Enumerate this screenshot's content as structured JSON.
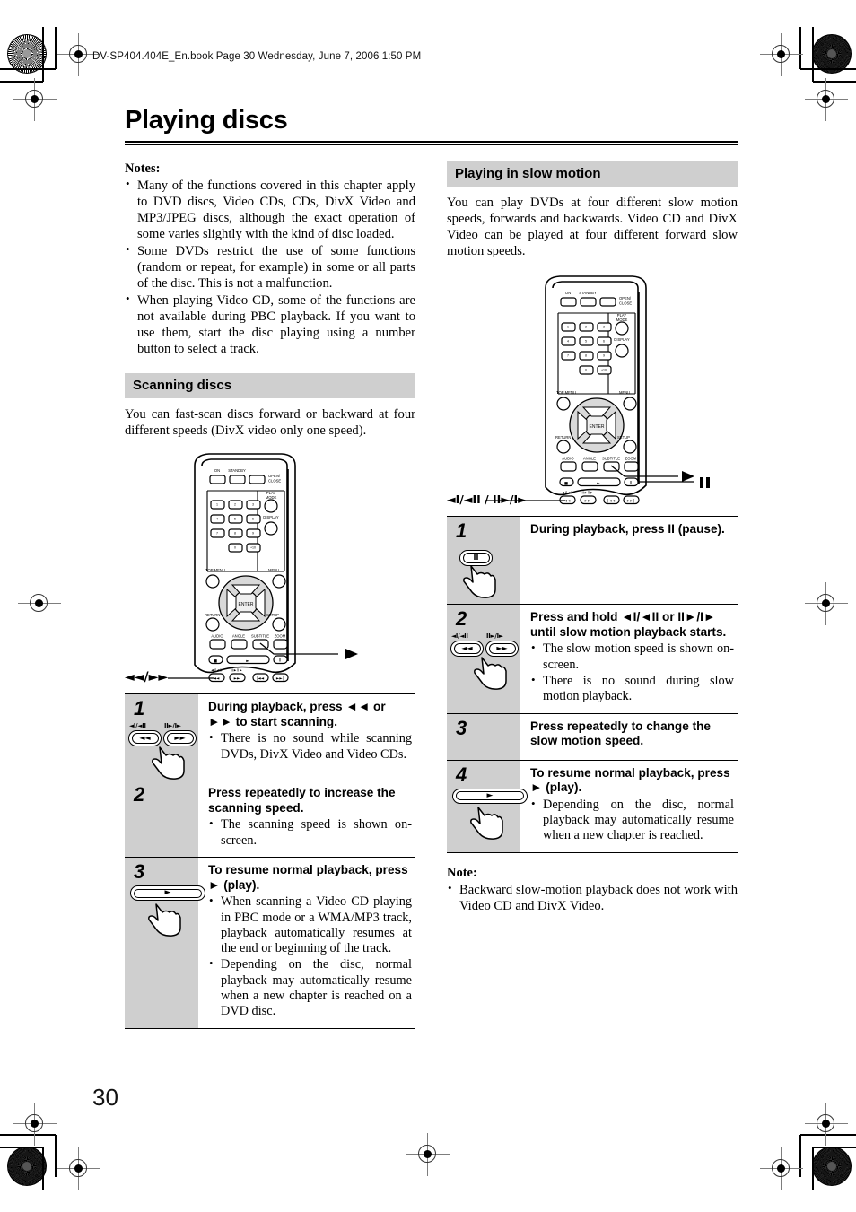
{
  "header": {
    "file_line": "DV-SP404.404E_En.book  Page 30  Wednesday, June 7, 2006  1:50 PM"
  },
  "page": {
    "title": "Playing discs",
    "page_number": "30"
  },
  "notes": {
    "heading": "Notes:",
    "items": [
      "Many of the functions covered in this chapter apply to DVD discs, Video CDs, CDs, DivX Video and MP3/JPEG discs, although the exact operation of some varies slightly with the kind of disc loaded.",
      "Some DVDs restrict the use of some functions (random or repeat, for example) in some or all parts of the disc. This is not a malfunction.",
      "When playing Video CD, some of the functions are not available during PBC playback. If you want to use them, start the disc playing using a number button to select a track."
    ]
  },
  "scanning": {
    "heading": "Scanning discs",
    "intro": "You can fast-scan discs forward or backward at four different speeds (DivX video only one speed).",
    "remote_callout_play": "►",
    "remote_callout_scan": "◄◄/►►",
    "steps": [
      {
        "num": "1",
        "heading": "During playback, press ◄◄ or ►► to start scanning.",
        "bullets": [
          "There is no sound while scanning DVDs, DivX Video and Video CDs."
        ],
        "button_left_label": "◄I/◄II",
        "button_right_label": "II►/I►",
        "button_left_glyph": "◄◄",
        "button_right_glyph": "►►"
      },
      {
        "num": "2",
        "heading": "Press repeatedly to increase the scanning speed.",
        "bullets": [
          "The scanning speed is shown on-screen."
        ]
      },
      {
        "num": "3",
        "heading": "To resume normal playback, press ► (play).",
        "bullets": [
          "When scanning a Video CD playing in PBC mode or a WMA/MP3 track, playback automatically resumes at the end or beginning of the track.",
          "Depending on the disc, normal playback may automatically resume when a new chapter is reached on a DVD disc."
        ],
        "play_glyph": "►"
      }
    ]
  },
  "slow_motion": {
    "heading": "Playing in slow motion",
    "intro": "You can play DVDs at four different slow motion speeds, forwards and backwards. Video CD and DivX Video can be played at four different forward slow motion speeds.",
    "remote_callout_play": "►",
    "remote_callout_pause": "II",
    "remote_callout_slow": "◄I/◄II / II►/I►",
    "steps": [
      {
        "num": "1",
        "heading": "During playback, press II (pause).",
        "bullets": [],
        "button_glyph": "II"
      },
      {
        "num": "2",
        "heading": "Press and hold ◄I/◄II or II►/I► until slow motion playback starts.",
        "bullets": [
          "The slow motion speed is shown on-screen.",
          "There is no sound during slow motion playback."
        ],
        "button_left_label": "◄I/◄II",
        "button_right_label": "II►/I►",
        "button_left_glyph": "◄◄",
        "button_right_glyph": "►►"
      },
      {
        "num": "3",
        "heading": "Press repeatedly to change the slow motion speed.",
        "bullets": []
      },
      {
        "num": "4",
        "heading": "To resume normal playback, press ► (play).",
        "bullets": [
          "Depending on the disc, normal playback may automatically resume when a new chapter is reached."
        ],
        "play_glyph": "►"
      }
    ],
    "note": {
      "heading": "Note:",
      "items": [
        "Backward slow-motion playback does not work with Video CD and DivX Video."
      ]
    }
  },
  "remote": {
    "labels": {
      "on": "ON",
      "standby": "STANDBY",
      "open_close": "OPEN/ CLOSE",
      "play_mode": "PLAY MODE",
      "display": "DISPLAY",
      "top_menu": "TOP MENU",
      "menu": "MENU",
      "return": "RETURN",
      "setup": "SETUP",
      "enter": "ENTER",
      "audio": "AUDIO",
      "angle": "ANGLE",
      "subtitle": "SUBTITLE",
      "zoom": "ZOOM",
      "keys": [
        "1",
        "2",
        "3",
        "4",
        "5",
        "6",
        "7",
        "8",
        "9",
        "0",
        "+10"
      ]
    }
  },
  "colors": {
    "section_header_bg": "#cfcfcf",
    "step_num_bg": "#cfcfcf",
    "rule": "#000000"
  }
}
